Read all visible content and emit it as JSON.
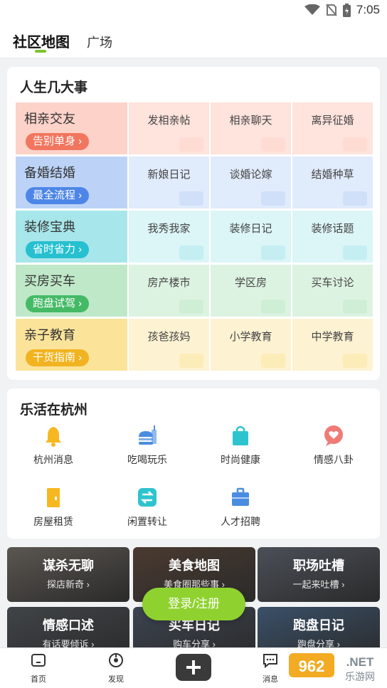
{
  "status_bar": {
    "time": "7:05"
  },
  "tabs": [
    {
      "label": "社区地图",
      "active": true
    },
    {
      "label": "广场",
      "active": false
    }
  ],
  "life_events": {
    "title": "人生几大事",
    "categories": [
      {
        "name": "相亲交友",
        "pill": "告别单身 ›",
        "subs": [
          "发相亲帖",
          "相亲聊天",
          "离异征婚"
        ],
        "colors": {
          "bg": "#ffe3dd",
          "bg_dark": "#fdd2c9",
          "pill": "#f1765f"
        }
      },
      {
        "name": "备婚结婚",
        "pill": "最全流程 ›",
        "subs": [
          "新娘日记",
          "谈婚论嫁",
          "结婚种草"
        ],
        "colors": {
          "bg": "#e0ebfc",
          "bg_dark": "#bcd3f7",
          "pill": "#4d86e8"
        }
      },
      {
        "name": "装修宝典",
        "pill": "省时省力 ›",
        "subs": [
          "我秀我家",
          "装修日记",
          "装修话题"
        ],
        "colors": {
          "bg": "#dcf5f7",
          "bg_dark": "#a7e6ea",
          "pill": "#26c0d0"
        }
      },
      {
        "name": "买房买车",
        "pill": "跑盘试驾 ›",
        "subs": [
          "房产楼市",
          "学区房",
          "买车讨论"
        ],
        "colors": {
          "bg": "#ddf3e2",
          "bg_dark": "#bfe8c8",
          "pill": "#45ba66"
        }
      },
      {
        "name": "亲子教育",
        "pill": "干货指南 ›",
        "subs": [
          "孩爸孩妈",
          "小学教育",
          "中学教育"
        ],
        "colors": {
          "bg": "#fdf2d2",
          "bg_dark": "#fbe49a",
          "pill": "#f2b320"
        }
      }
    ]
  },
  "hangzhou": {
    "title": "乐活在杭州",
    "items": [
      {
        "label": "杭州消息",
        "icon": "bell-icon",
        "color": "#f6b820"
      },
      {
        "label": "吃喝玩乐",
        "icon": "burger-drink-icon",
        "color": "#4a8de0"
      },
      {
        "label": "时尚健康",
        "icon": "shopping-bag-icon",
        "color": "#2ec4cf"
      },
      {
        "label": "情感八卦",
        "icon": "heart-chat-icon",
        "color": "#f07a76"
      },
      {
        "label": "房屋租赁",
        "icon": "door-icon",
        "color": "#f6b820"
      },
      {
        "label": "闲置转让",
        "icon": "exchange-icon",
        "color": "#2ec4cf"
      },
      {
        "label": "人才招聘",
        "icon": "briefcase-icon",
        "color": "#4a8de0"
      }
    ]
  },
  "topics": [
    {
      "title": "谋杀无聊",
      "sub": "探店新奇 ›",
      "bg": "#5b5650"
    },
    {
      "title": "美食地图",
      "sub": "美食圈那些事 ›",
      "bg": "#4a3a30"
    },
    {
      "title": "职场吐槽",
      "sub": "一起来吐槽 ›",
      "bg": "#4b5058"
    },
    {
      "title": "情感口述",
      "sub": "有话要倾诉 ›",
      "bg": "#404448"
    },
    {
      "title": "买车日记",
      "sub": "购车分享 ›",
      "bg": "#3c4450"
    },
    {
      "title": "跑盘日记",
      "sub": "跑盘分享 ›",
      "bg": "#3a5068"
    }
  ],
  "login_button": "登录/注册",
  "bottom_nav": [
    {
      "label": "首页",
      "icon": "home-icon"
    },
    {
      "label": "发现",
      "icon": "compass-icon"
    },
    {
      "label": "",
      "icon": "plus-icon"
    },
    {
      "label": "消息",
      "icon": "message-icon"
    }
  ],
  "watermark": {
    "brand": "962",
    "suffix": ".NET",
    "sub": "乐游网"
  }
}
